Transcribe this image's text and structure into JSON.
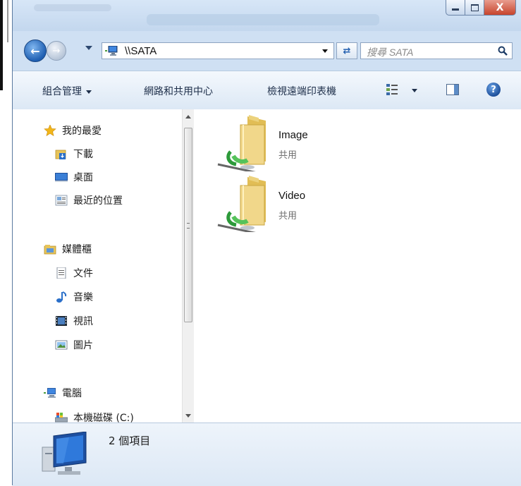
{
  "window": {
    "caption_buttons": {
      "minimize": "",
      "maximize": "",
      "close": "X"
    }
  },
  "nav": {
    "address": "\\\\SATA",
    "search_placeholder": "搜尋 SATA"
  },
  "commandbar": {
    "organize": "組合管理",
    "network_center": "網路和共用中心",
    "view_printers": "檢視遠端印表機"
  },
  "sidebar": {
    "favorites": {
      "label": "我的最愛",
      "items": [
        "下載",
        "桌面",
        "最近的位置"
      ]
    },
    "libraries": {
      "label": "媒體櫃",
      "items": [
        "文件",
        "音樂",
        "視訊",
        "圖片"
      ]
    },
    "computer": {
      "label": "電腦",
      "items": [
        "本機磁碟 (C:)"
      ]
    }
  },
  "folders": [
    {
      "name": "Image",
      "type": "共用"
    },
    {
      "name": "Video",
      "type": "共用"
    }
  ],
  "details": {
    "count": "2 個項目"
  },
  "colors": {
    "accent": "#1f5fb2",
    "close": "#c7442c",
    "folder": "#e9c95a"
  }
}
